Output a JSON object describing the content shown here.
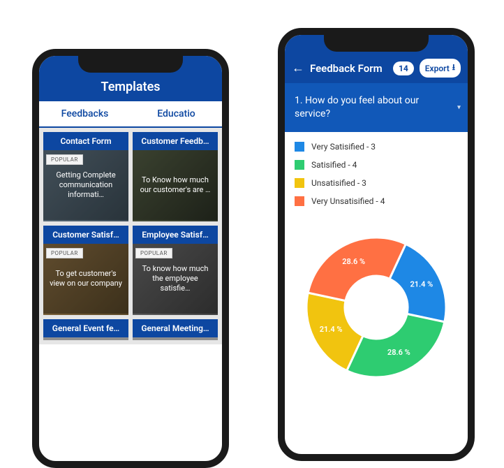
{
  "colors": {
    "primary": "#0d47a1",
    "series": [
      "#1e88e5",
      "#2ecc71",
      "#f1c40f",
      "#ff7043"
    ]
  },
  "phoneA": {
    "title": "Templates",
    "tabs": [
      "Feedbacks",
      "Educatio"
    ],
    "popularLabel": "POPULAR",
    "cards": [
      {
        "title": "Contact Form",
        "desc": "Getting Complete communication informati…",
        "popular": true
      },
      {
        "title": "Customer Feedb…",
        "desc": "To Know how much our customer's are …",
        "popular": false
      },
      {
        "title": "Customer Satisf…",
        "desc": "To get customer's view on our company",
        "popular": true
      },
      {
        "title": "Employee Satisf…",
        "desc": "To know how much the employee satisfie…",
        "popular": true
      },
      {
        "title": "General Event fe…",
        "desc": "",
        "popular": false
      },
      {
        "title": "General Meeting…",
        "desc": "",
        "popular": false
      }
    ]
  },
  "phoneB": {
    "title": "Feedback Form",
    "count": "14",
    "exportLabel": "Export",
    "question": "1. How do you feel about our service?",
    "legend": [
      {
        "label": "Very Satisified - 3"
      },
      {
        "label": "Satisified - 4"
      },
      {
        "label": "Unsatisified - 3"
      },
      {
        "label": "Very Unsatisified - 4"
      }
    ]
  },
  "chart_data": {
    "type": "pie",
    "title": "",
    "series": [
      {
        "name": "Very Satisified",
        "value": 3,
        "percent": 21.4,
        "label": "21.4 %",
        "color": "#1e88e5"
      },
      {
        "name": "Satisified",
        "value": 4,
        "percent": 28.6,
        "label": "28.6 %",
        "color": "#2ecc71"
      },
      {
        "name": "Unsatisified",
        "value": 3,
        "percent": 21.4,
        "label": "21.4 %",
        "color": "#f1c40f"
      },
      {
        "name": "Very Unsatisified",
        "value": 4,
        "percent": 28.6,
        "label": "28.6 %",
        "color": "#ff7043"
      }
    ],
    "donut_inner_ratio": 0.45
  }
}
